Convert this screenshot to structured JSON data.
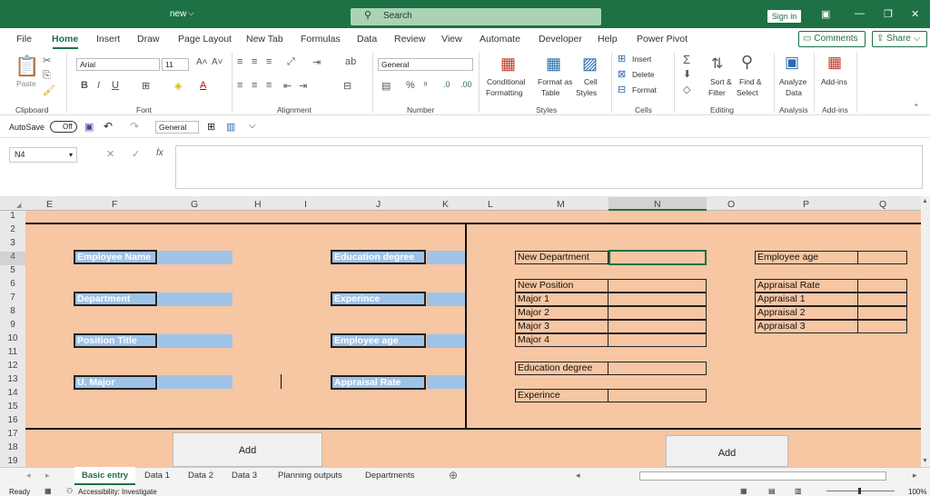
{
  "title": "new",
  "search_placeholder": "Search",
  "sign_in": "Sign in",
  "menus": [
    "File",
    "Home",
    "Insert",
    "Draw",
    "Page Layout",
    "New Tab",
    "Formulas",
    "Data",
    "Review",
    "View",
    "Automate",
    "Developer",
    "Help",
    "Power Pivot"
  ],
  "comments": "Comments",
  "share": "Share",
  "ribbon": {
    "paste": "Paste",
    "font_name": "Arial",
    "font_size": "11",
    "number_format": "General",
    "conditional1": "Conditional",
    "conditional2": "Formatting",
    "formatas1": "Format as",
    "formatas2": "Table",
    "cell1": "Cell",
    "cell2": "Styles",
    "insert": "Insert",
    "delete": "Delete",
    "format": "Format",
    "sort1": "Sort &",
    "sort2": "Filter",
    "find1": "Find &",
    "find2": "Select",
    "analyze1": "Analyze",
    "analyze2": "Data",
    "addins": "Add-ins",
    "groups": [
      "Clipboard",
      "Font",
      "Alignment",
      "Number",
      "Styles",
      "Cells",
      "Editing",
      "Analysis",
      "Add-ins"
    ]
  },
  "qat": {
    "autosave": "AutoSave",
    "toggle": "Off",
    "format": "General"
  },
  "name_box": "N4",
  "columns": [
    "E",
    "F",
    "G",
    "H",
    "I",
    "J",
    "K",
    "L",
    "M",
    "N",
    "O",
    "P",
    "Q"
  ],
  "rows": [
    "1",
    "2",
    "3",
    "4",
    "5",
    "6",
    "7",
    "8",
    "9",
    "10",
    "11",
    "12",
    "13",
    "14",
    "15",
    "16",
    "17",
    "18",
    "19"
  ],
  "left_labels": [
    "Employee Name",
    "Department",
    "Position Title",
    "U. Major"
  ],
  "mid_labels": [
    "Education degree",
    "Experince",
    "Employee age",
    "Appraisal Rate"
  ],
  "right_cells": [
    "New Department",
    "New Position",
    "Major 1",
    "Major 2",
    "Major 3",
    "Major 4",
    "Education degree",
    "Experince"
  ],
  "far_cells": [
    "Employee age",
    "Appraisal Rate",
    "Appraisal 1",
    "Appraisal 2",
    "Appraisal 3"
  ],
  "add1": "Add",
  "add2": "Add",
  "sheets": [
    "Basic entry",
    "Data 1",
    "Data 2",
    "Data 3",
    "Planning outputs",
    "Departments"
  ],
  "status": {
    "ready": "Ready",
    "accessibility": "Accessibility: Investigate",
    "zoom": "100%"
  }
}
